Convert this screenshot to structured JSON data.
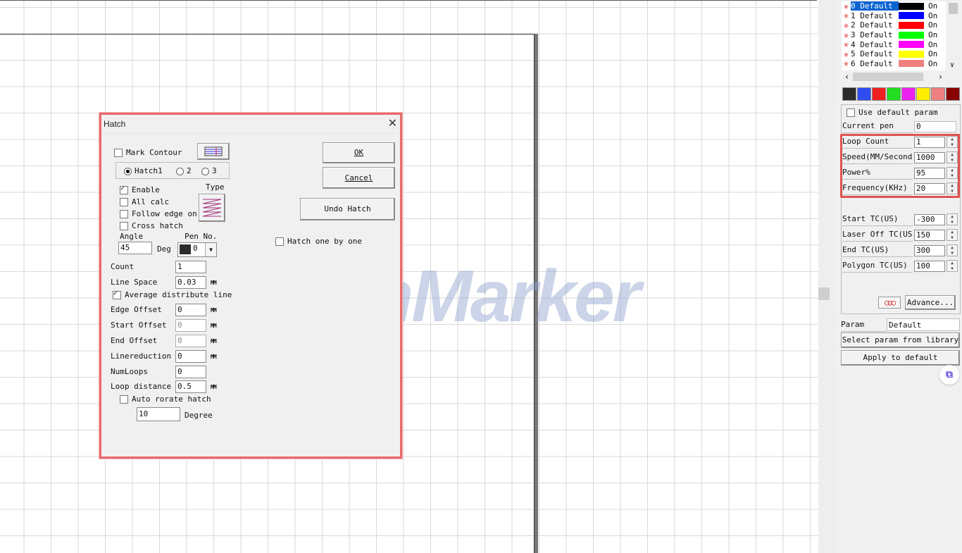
{
  "pens": [
    {
      "label": "0 Default",
      "color": "#000000",
      "state": "On"
    },
    {
      "label": "1 Default",
      "color": "#0000ff",
      "state": "On"
    },
    {
      "label": "2 Default",
      "color": "#ff0000",
      "state": "On"
    },
    {
      "label": "3 Default",
      "color": "#00ff00",
      "state": "On"
    },
    {
      "label": "4 Default",
      "color": "#ff00ff",
      "state": "On"
    },
    {
      "label": "5 Default",
      "color": "#ffff00",
      "state": "On"
    },
    {
      "label": "6 Default",
      "color": "#f08080",
      "state": "On"
    }
  ],
  "palette": [
    "#2b2b2b",
    "#2f4cf0",
    "#f02020",
    "#22dd22",
    "#ee22ee",
    "#ffee00",
    "#f08080",
    "#880000"
  ],
  "panel": {
    "use_default_param": "Use default param",
    "current_pen_label": "Current pen",
    "current_pen_value": "0",
    "loop_count_label": "Loop Count",
    "loop_count_value": "1",
    "speed_label": "Speed(MM/Second",
    "speed_value": "1000",
    "power_label": "Power%",
    "power_value": "95",
    "frequency_label": "Frequency(KHz)",
    "frequency_value": "20",
    "start_tc_label": "Start TC(US)",
    "start_tc_value": "-300",
    "laser_off_tc_label": "Laser Off TC(US",
    "laser_off_tc_value": "150",
    "end_tc_label": "End TC(US)",
    "end_tc_value": "300",
    "polygon_tc_label": "Polygon TC(US)",
    "polygon_tc_value": "100",
    "advance_label": "Advance...",
    "param_name_label": "Param name",
    "param_name_value": "Default",
    "select_param_label": "Select param from library",
    "apply_default_label": "Apply to default"
  },
  "watermark": "ComMarker",
  "dialog": {
    "title": "Hatch",
    "mark_contour": "Mark Contour",
    "hatch1": "Hatch1",
    "hatch2": "2",
    "hatch3": "3",
    "enable": "Enable",
    "all_calc": "All calc",
    "follow_edge": "Follow edge on",
    "cross_hatch": "Cross hatch",
    "type_label": "Type",
    "angle_label": "Angle",
    "angle_value": "45",
    "deg_label": "Deg",
    "pen_no_label": "Pen No.",
    "pen_no_value": "0",
    "count_label": "Count",
    "count_value": "1",
    "line_space_label": "Line Space",
    "line_space_value": "0.03",
    "average_distribute": "Average distribute line",
    "edge_offset_label": "Edge Offset",
    "edge_offset_value": "0",
    "start_offset_label": "Start Offset",
    "start_offset_value": "0",
    "end_offset_label": "End Offset",
    "end_offset_value": "0",
    "linereduction_label": "Linereduction",
    "linereduction_value": "0",
    "numloops_label": "NumLoops",
    "numloops_value": "0",
    "loop_distance_label": "Loop distance",
    "loop_distance_value": "0.5",
    "auto_rotate": "Auto rorate hatch",
    "auto_rotate_value": "10",
    "degree_label": "Degree",
    "unit_mm": "MM",
    "ok": "OK",
    "cancel": "Cancel",
    "undo_hatch": "Undo Hatch",
    "hatch_one_by_one": "Hatch one by one"
  }
}
